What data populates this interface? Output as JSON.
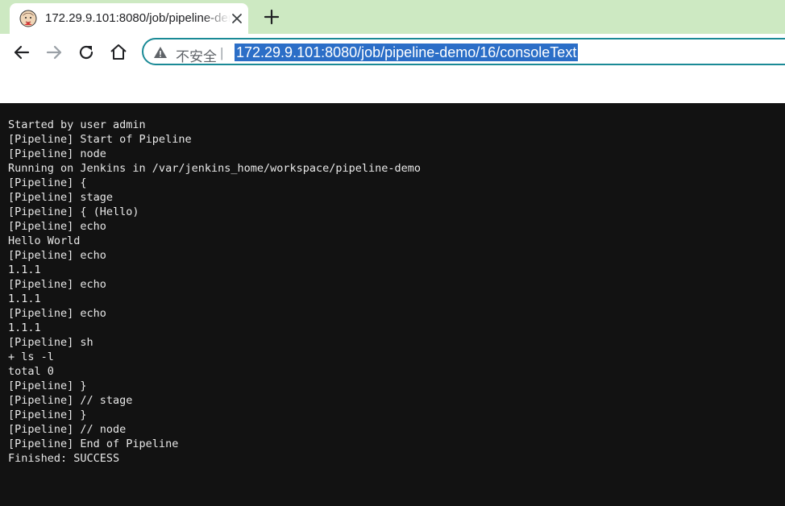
{
  "browser": {
    "tab": {
      "title": "172.29.9.101:8080/job/pipeline-demo/16/consoleText",
      "favicon": "jenkins-butler-icon"
    },
    "omnibox": {
      "security_label": "不安全",
      "divider": "|",
      "url": "172.29.9.101:8080/job/pipeline-demo/16/consoleText"
    },
    "icons": {
      "close": "close-icon",
      "new_tab": "plus-icon",
      "back": "back-arrow-icon",
      "forward": "forward-arrow-icon",
      "reload": "reload-icon",
      "home": "home-icon",
      "warning": "warning-triangle-icon"
    },
    "colors": {
      "tab_strip": "#cde9c2",
      "omnibox_border": "#1a8a96",
      "url_selection": "#2b6ec7",
      "console_bg": "#121212"
    }
  },
  "console": {
    "lines": [
      "Started by user admin",
      "[Pipeline] Start of Pipeline",
      "[Pipeline] node",
      "Running on Jenkins in /var/jenkins_home/workspace/pipeline-demo",
      "[Pipeline] {",
      "[Pipeline] stage",
      "[Pipeline] { (Hello)",
      "[Pipeline] echo",
      "Hello World",
      "[Pipeline] echo",
      "1.1.1",
      "[Pipeline] echo",
      "1.1.1",
      "[Pipeline] echo",
      "1.1.1",
      "[Pipeline] sh",
      "+ ls -l",
      "total 0",
      "[Pipeline] }",
      "[Pipeline] // stage",
      "[Pipeline] }",
      "[Pipeline] // node",
      "[Pipeline] End of Pipeline",
      "Finished: SUCCESS"
    ]
  }
}
